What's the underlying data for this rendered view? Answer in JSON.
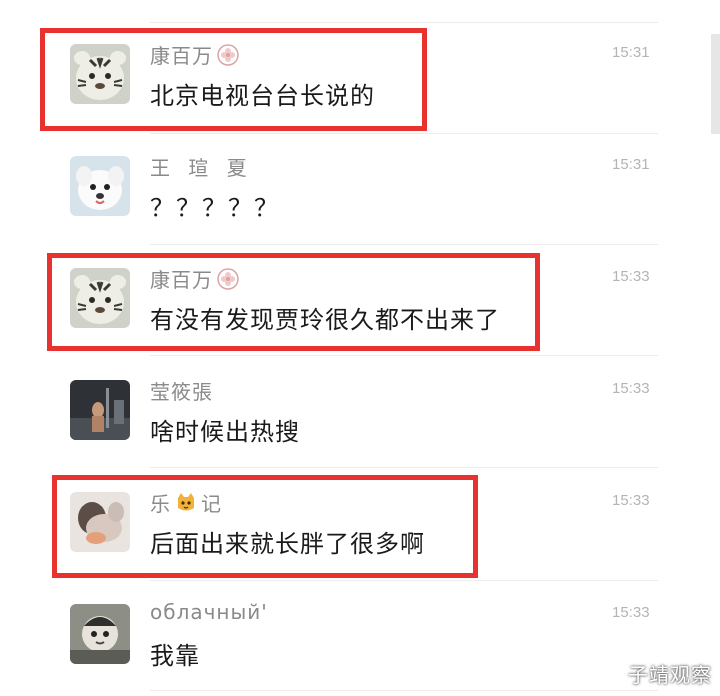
{
  "messages": [
    {
      "name": "康百万",
      "name_badge": "flower-badge-icon",
      "time": "15:31",
      "text": "北京电视台台长说的",
      "highlighted": true,
      "avatar": "tiger-avatar"
    },
    {
      "name": "王 瑄 夏",
      "name_badge": "",
      "time": "15:31",
      "text": "？？？？？",
      "highlighted": false,
      "avatar": "dog-avatar"
    },
    {
      "name": "康百万",
      "name_badge": "flower-badge-icon",
      "time": "15:33",
      "text": "有没有发现贾玲很久都不出来了",
      "highlighted": true,
      "avatar": "tiger-avatar"
    },
    {
      "name": "莹筱張",
      "name_badge": "",
      "time": "15:33",
      "text": "啥时候出热搜",
      "highlighted": false,
      "avatar": "photo-avatar"
    },
    {
      "name_prefix": "乐",
      "name_suffix": "记",
      "name_badge": "cat-emoji-icon",
      "time": "15:33",
      "text": "后面出来就长胖了很多啊",
      "highlighted": true,
      "avatar": "blur-avatar"
    },
    {
      "name": "облачный'",
      "name_badge": "",
      "time": "15:33",
      "text": "我靠",
      "highlighted": false,
      "avatar": "cartoon-avatar"
    }
  ],
  "watermark": "子靖观察",
  "colors": {
    "highlight": "#e8322f",
    "name": "#8a8a8a",
    "time": "#b4b4b4",
    "text": "#1a1a1a"
  }
}
